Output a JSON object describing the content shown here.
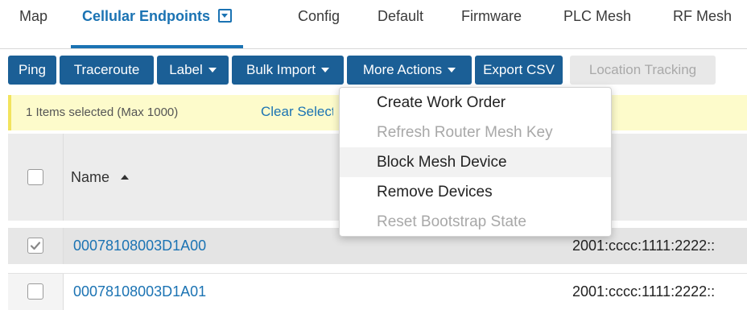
{
  "tabs": [
    {
      "label": "Map"
    },
    {
      "label": "Cellular Endpoints"
    },
    {
      "label": "Config"
    },
    {
      "label": "Default"
    },
    {
      "label": "Firmware"
    },
    {
      "label": "PLC Mesh"
    },
    {
      "label": "RF Mesh"
    }
  ],
  "active_tab": "Cellular Endpoints",
  "toolbar": {
    "ping": "Ping",
    "traceroute": "Traceroute",
    "label": "Label",
    "bulk_import": "Bulk Import",
    "more_actions": "More Actions",
    "export_csv": "Export CSV",
    "location_tracking": "Location Tracking"
  },
  "selection_banner": {
    "text": "1 Items selected (Max 1000)",
    "link": "Clear Selection"
  },
  "table": {
    "columns": {
      "name": "Name"
    },
    "sort": "ascending",
    "rows": [
      {
        "name": "00078108003D1A00",
        "ip": "2001:cccc:1111:2222::",
        "checked": true
      },
      {
        "name": "00078108003D1A01",
        "ip": "2001:cccc:1111:2222::",
        "checked": false
      }
    ]
  },
  "more_actions_menu": {
    "items": [
      {
        "label": "Create Work Order",
        "enabled": true
      },
      {
        "label": "Refresh Router Mesh Key",
        "enabled": false
      },
      {
        "label": "Block Mesh Device",
        "enabled": true,
        "highlighted": true
      },
      {
        "label": "Remove Devices",
        "enabled": true
      },
      {
        "label": "Reset Bootstrap State",
        "enabled": false
      }
    ]
  },
  "colors": {
    "accent": "#1b73b3",
    "toolbar_button": "#1b5f96",
    "banner_bg": "#fdfbcb"
  },
  "icons": {
    "tab_dropdown": "caret-square-down-icon",
    "sort": "sort-ascending-icon",
    "checkbox_checked": "checkmark-icon"
  }
}
